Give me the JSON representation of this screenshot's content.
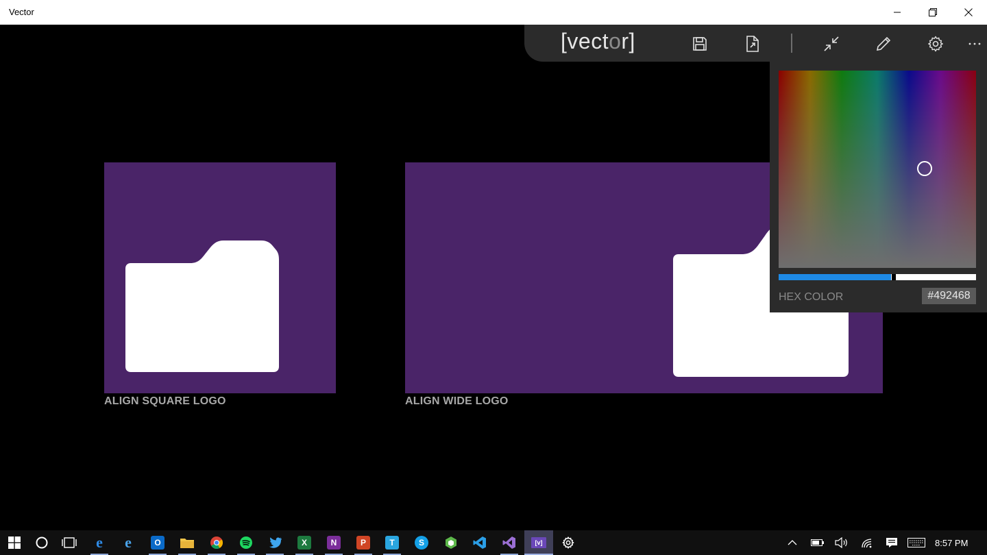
{
  "window": {
    "title": "Vector",
    "controls": {
      "minimize": "minimize-icon",
      "restore": "restore-icon",
      "close": "close-icon"
    }
  },
  "commandbar": {
    "brand_open": "[vect",
    "brand_dim": "o",
    "brand_close": "r]",
    "icons": [
      "save-icon",
      "export-file-icon",
      "collapse-icon",
      "pen-icon",
      "gear-icon",
      "more-icon"
    ]
  },
  "tiles": {
    "square_label": "ALIGN SQUARE LOGO",
    "wide_label": "ALIGN WIDE LOGO",
    "tile_color": "#4a2468",
    "logo_color": "#ffffff"
  },
  "color_picker": {
    "hex_label": "HEX COLOR",
    "hex_value": "#492468",
    "hue_slider_value": 0.57,
    "slider_color": "#1e8ae6"
  },
  "taskbar": {
    "apps": [
      "windows-start-icon",
      "cortana-icon",
      "task-view-icon",
      "edge-icon",
      "internet-explorer-icon",
      "outlook-icon",
      "file-explorer-icon",
      "chrome-icon",
      "spotify-icon",
      "twitter-icon",
      "excel-icon",
      "onenote-icon",
      "powerpoint-icon",
      "tile-app-icon",
      "skype-icon",
      "cube-app-icon",
      "vscode-icon",
      "visual-studio-icon",
      "vector-app-icon",
      "settings-icon"
    ],
    "tray_icons": [
      "show-hidden-icons-chevron",
      "battery-icon",
      "volume-icon",
      "wifi-icon",
      "action-center-icon",
      "keyboard-icon"
    ],
    "clock": "8:57 PM"
  }
}
